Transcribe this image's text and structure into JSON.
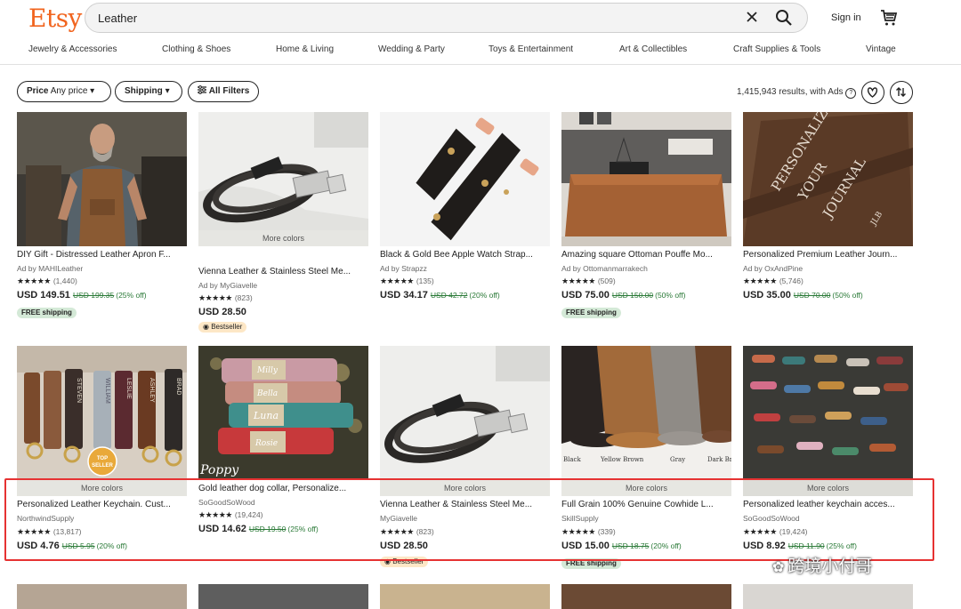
{
  "header": {
    "logo": "Etsy",
    "search_value": "Leather",
    "signin": "Sign in"
  },
  "categories": [
    "Jewelry & Accessories",
    "Clothing & Shoes",
    "Home & Living",
    "Wedding & Party",
    "Toys & Entertainment",
    "Art & Collectibles",
    "Craft Supplies & Tools",
    "Vintage"
  ],
  "filters": {
    "price_label": "Price",
    "price_value": "Any price",
    "shipping": "Shipping",
    "all_filters": "All Filters",
    "results": "1,415,943 results, with Ads"
  },
  "listings": [
    {
      "title": "DIY Gift - Distressed Leather Apron F...",
      "shop": "Ad by MAHILeather",
      "stars": "★★★★★",
      "reviews": "(1,440)",
      "price": "USD 149.51",
      "old": "USD 199.35",
      "off": "(25% off)",
      "badge": "FREE shipping",
      "more": ""
    },
    {
      "title": "Vienna Leather & Stainless Steel Me...",
      "shop": "Ad by MyGiavelle",
      "stars": "★★★★★",
      "reviews": "(823)",
      "price": "USD 28.50",
      "old": "",
      "off": "",
      "badge": "Bestseller",
      "more": "More colors"
    },
    {
      "title": "Black & Gold Bee Apple Watch Strap...",
      "shop": "Ad by Strapzz",
      "stars": "★★★★★",
      "reviews": "(135)",
      "price": "USD 34.17",
      "old": "USD 42.72",
      "off": "(20% off)",
      "badge": "",
      "more": ""
    },
    {
      "title": "Amazing square Ottoman Pouffe Mo...",
      "shop": "Ad by Ottomanmarrakech",
      "stars": "★★★★★",
      "reviews": "(509)",
      "price": "USD 75.00",
      "old": "USD 150.00",
      "off": "(50% off)",
      "badge": "FREE shipping",
      "more": ""
    },
    {
      "title": "Personalized Premium Leather Journ...",
      "shop": "Ad by OxAndPine",
      "stars": "★★★★★",
      "reviews": "(5,746)",
      "price": "USD 35.00",
      "old": "USD 70.00",
      "off": "(50% off)",
      "badge": "",
      "more": ""
    },
    {
      "title": "Personalized Leather Keychain. Cust...",
      "shop": "NorthwindSupply",
      "stars": "★★★★★",
      "reviews": "(13,817)",
      "price": "USD 4.76",
      "old": "USD 5.95",
      "off": "(20% off)",
      "badge": "",
      "more": "More colors"
    },
    {
      "title": "Gold leather dog collar, Personalize...",
      "shop": "SoGoodSoWood",
      "stars": "★★★★★",
      "reviews": "(19,424)",
      "price": "USD 14.62",
      "old": "USD 19.50",
      "off": "(25% off)",
      "badge": "",
      "more": ""
    },
    {
      "title": "Vienna Leather & Stainless Steel Me...",
      "shop": "MyGiavelle",
      "stars": "★★★★★",
      "reviews": "(823)",
      "price": "USD 28.50",
      "old": "",
      "off": "",
      "badge": "Bestseller",
      "more": "More colors"
    },
    {
      "title": "Full Grain 100% Genuine Cowhide L...",
      "shop": "SkillSupply",
      "stars": "★★★★★",
      "reviews": "(339)",
      "price": "USD 15.00",
      "old": "USD 18.75",
      "off": "(20% off)",
      "badge": "FREE shipping",
      "more": "More colors"
    },
    {
      "title": "Personalized leather keychain acces...",
      "shop": "SoGoodSoWood",
      "stars": "★★★★★",
      "reviews": "(19,424)",
      "price": "USD 8.92",
      "old": "USD 11.90",
      "off": "(25% off)",
      "badge": "",
      "more": "More colors"
    }
  ],
  "image_labels": {
    "journal_1": "PERSONALIZE",
    "journal_2": "YOUR",
    "journal_3": "JOURNAL",
    "journal_initials": "JLB",
    "top_seller_1": "TOP",
    "top_seller_2": "SELLER",
    "collar_name_1": "Milly",
    "collar_name_2": "Bella",
    "collar_name_3": "Luna",
    "collar_name_4": "Rosie",
    "collar_name_5": "Poppy",
    "hide_1": "Black",
    "hide_2": "Yellow Brown",
    "hide_3": "Gray",
    "hide_4": "Dark Br",
    "keychain_1": "STEVEN",
    "keychain_2": "LESLIE",
    "keychain_3": "ASHLEY",
    "keychain_4": "BRAD",
    "keychain_5": "WILLIAM"
  },
  "watermark": "跨境小付哥",
  "colors": {
    "brand": "#f1641e",
    "highlight": "#e63232",
    "sale": "#2b7a38"
  }
}
